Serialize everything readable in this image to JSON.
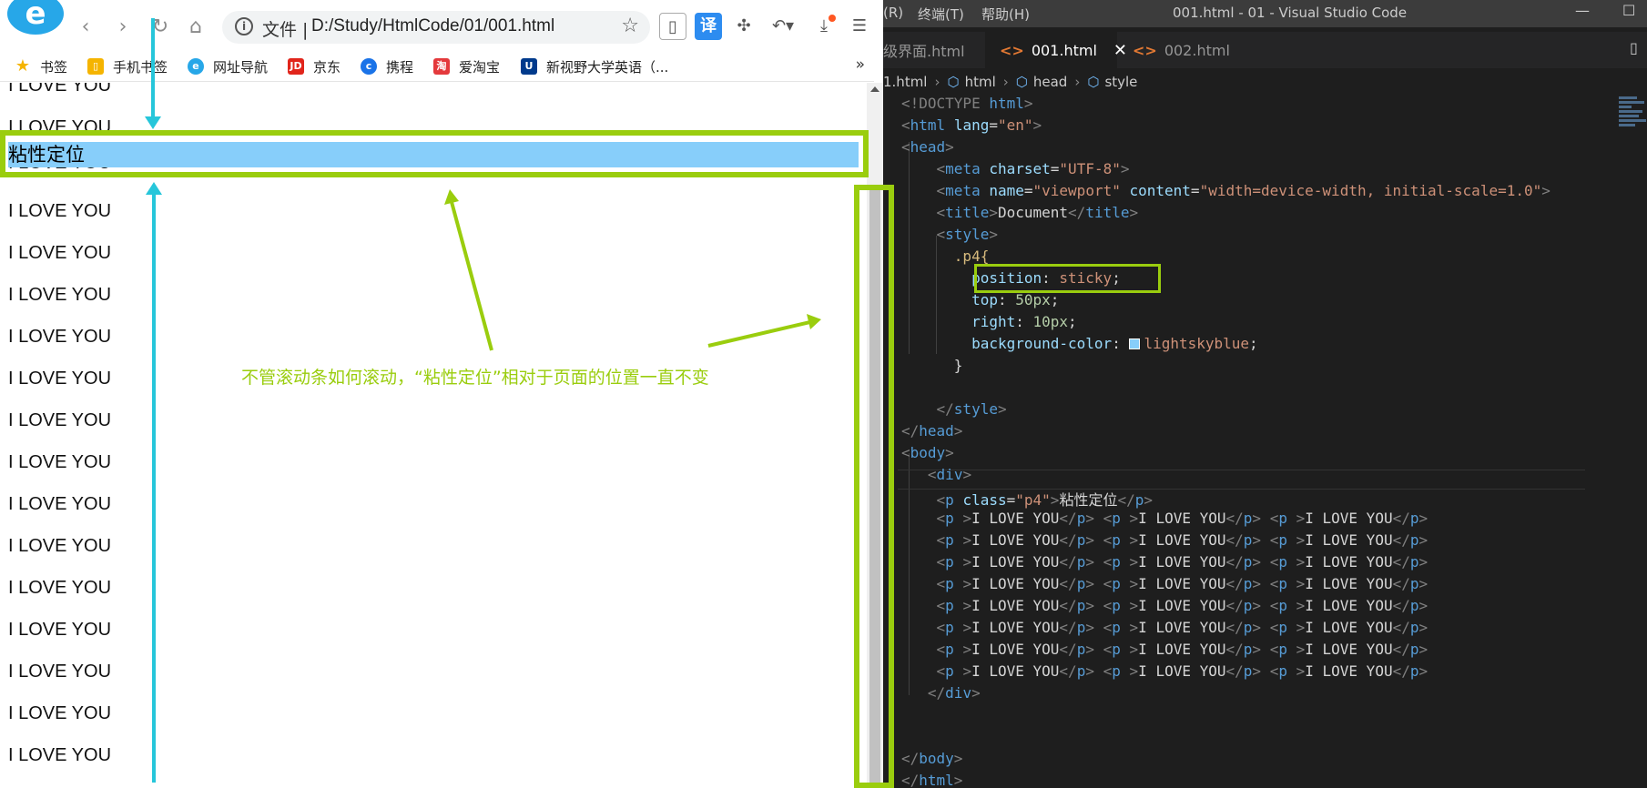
{
  "browser": {
    "logo_letter": "e",
    "nav": {
      "back": "‹",
      "forward": "›",
      "reload": "↻",
      "home": "⌂"
    },
    "address": {
      "scheme_label": "文件",
      "url": "D:/Study/HtmlCode/01/001.html"
    },
    "toolbar_icons": [
      "reader-icon",
      "translate-icon",
      "extensions-icon",
      "undo-icon",
      "download-icon",
      "menu-icon"
    ],
    "translate_label": "译",
    "bookmarks": [
      {
        "label": "书签",
        "icon": "star-icon",
        "color": "#f5b400"
      },
      {
        "label": "手机书签",
        "icon": "phone-icon",
        "color": "#f5b400"
      },
      {
        "label": "网址导航",
        "icon": "nav-icon",
        "color": "#27a7e8"
      },
      {
        "label": "京东",
        "icon": "jd-icon",
        "color": "#e1251b"
      },
      {
        "label": "携程",
        "icon": "ctrip-icon",
        "color": "#1a73e8"
      },
      {
        "label": "爱淘宝",
        "icon": "taobao-icon",
        "color": "#e4393c"
      },
      {
        "label": "新视野大学英语（...",
        "icon": "u-icon",
        "color": "#003a8c"
      }
    ],
    "bookmarks_more": "»",
    "page": {
      "sticky_text": "粘性定位",
      "repeated_text": "I LOVE YOU",
      "annotation": "不管滚动条如何滚动，“粘性定位”相对于页面的位置一直不变"
    }
  },
  "vscode": {
    "menu": [
      "(R)",
      "终端(T)",
      "帮助(H)"
    ],
    "window_title": "001.html - 01 - Visual Studio Code",
    "tabs": [
      {
        "label": "级界面.html",
        "active": false
      },
      {
        "label": "001.html",
        "active": true,
        "close": "✕"
      },
      {
        "label": "002.html",
        "active": false,
        "dirty": true
      }
    ],
    "breadcrumb": [
      "1.html",
      "html",
      "head",
      "style"
    ],
    "code": {
      "doctype": "<!DOCTYPE",
      "doctype_kw": "html",
      "lang_val": "\"en\"",
      "charset_val": "\"UTF-8\"",
      "viewport_val": "\"viewport\"",
      "content_val": "\"width=device-width, initial-scale=1.0\"",
      "title_text": "Document",
      "selector": ".p4{",
      "position_val": "sticky",
      "top_val": "50px",
      "right_val": "10px",
      "bg_val": "lightskyblue",
      "class_val": "\"p4\"",
      "p4_text": "粘性定位",
      "row_text": "I LOVE YOU"
    }
  },
  "colors": {
    "highlight": "#9acd0e",
    "arrow_cyan": "#26c6da",
    "sticky_bg": "#87cefa"
  }
}
